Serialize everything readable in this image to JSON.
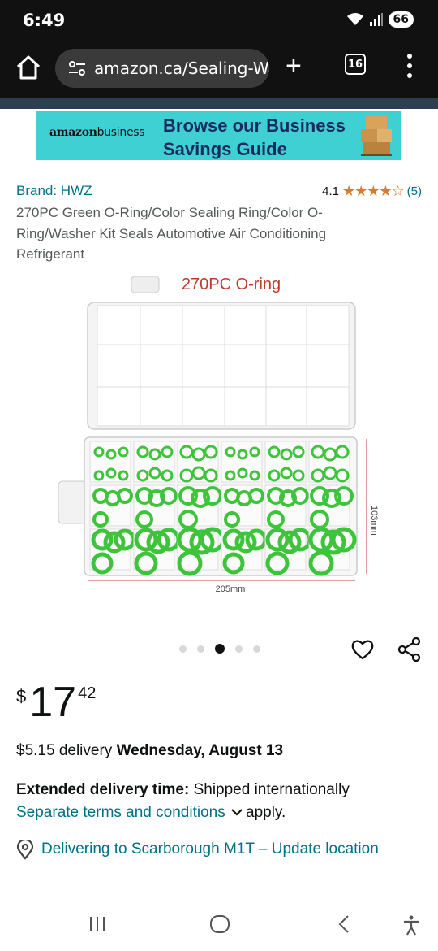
{
  "status_bar": {
    "time": "6:49",
    "battery": "66"
  },
  "browser": {
    "url": "amazon.ca/Sealing-Wa",
    "tab_count": "16"
  },
  "banner": {
    "logo_main": "amazon",
    "logo_sub": "business",
    "line1": "Browse our Business",
    "line2": "Savings Guide"
  },
  "product": {
    "brand": "Brand: HWZ",
    "rating": "4.1",
    "stars": "★★★★☆",
    "review_count": "(5)",
    "title": "270PC Green O-Ring/Color Sealing Ring/Color O-Ring/Washer Kit Seals Automotive Air Conditioning Refrigerant",
    "image_caption": "270PC O-ring",
    "image_width_label": "205mm",
    "image_height_label": "103mm",
    "image_count": 5,
    "active_image": 3
  },
  "price": {
    "currency": "$",
    "whole": "17",
    "fraction": "42"
  },
  "delivery": {
    "prefix": "$5.15 delivery ",
    "date": "Wednesday, August 13"
  },
  "extended": {
    "label": "Extended delivery time:",
    "text": " Shipped internationally",
    "link": "Separate terms and conditions",
    "suffix": "apply."
  },
  "location": {
    "text": "Delivering to Scarborough M1T – Update location"
  },
  "colors": {
    "link": "#007185",
    "star": "#de7921",
    "banner": "#3fd0d4",
    "ring_green": "#3ec43a"
  }
}
